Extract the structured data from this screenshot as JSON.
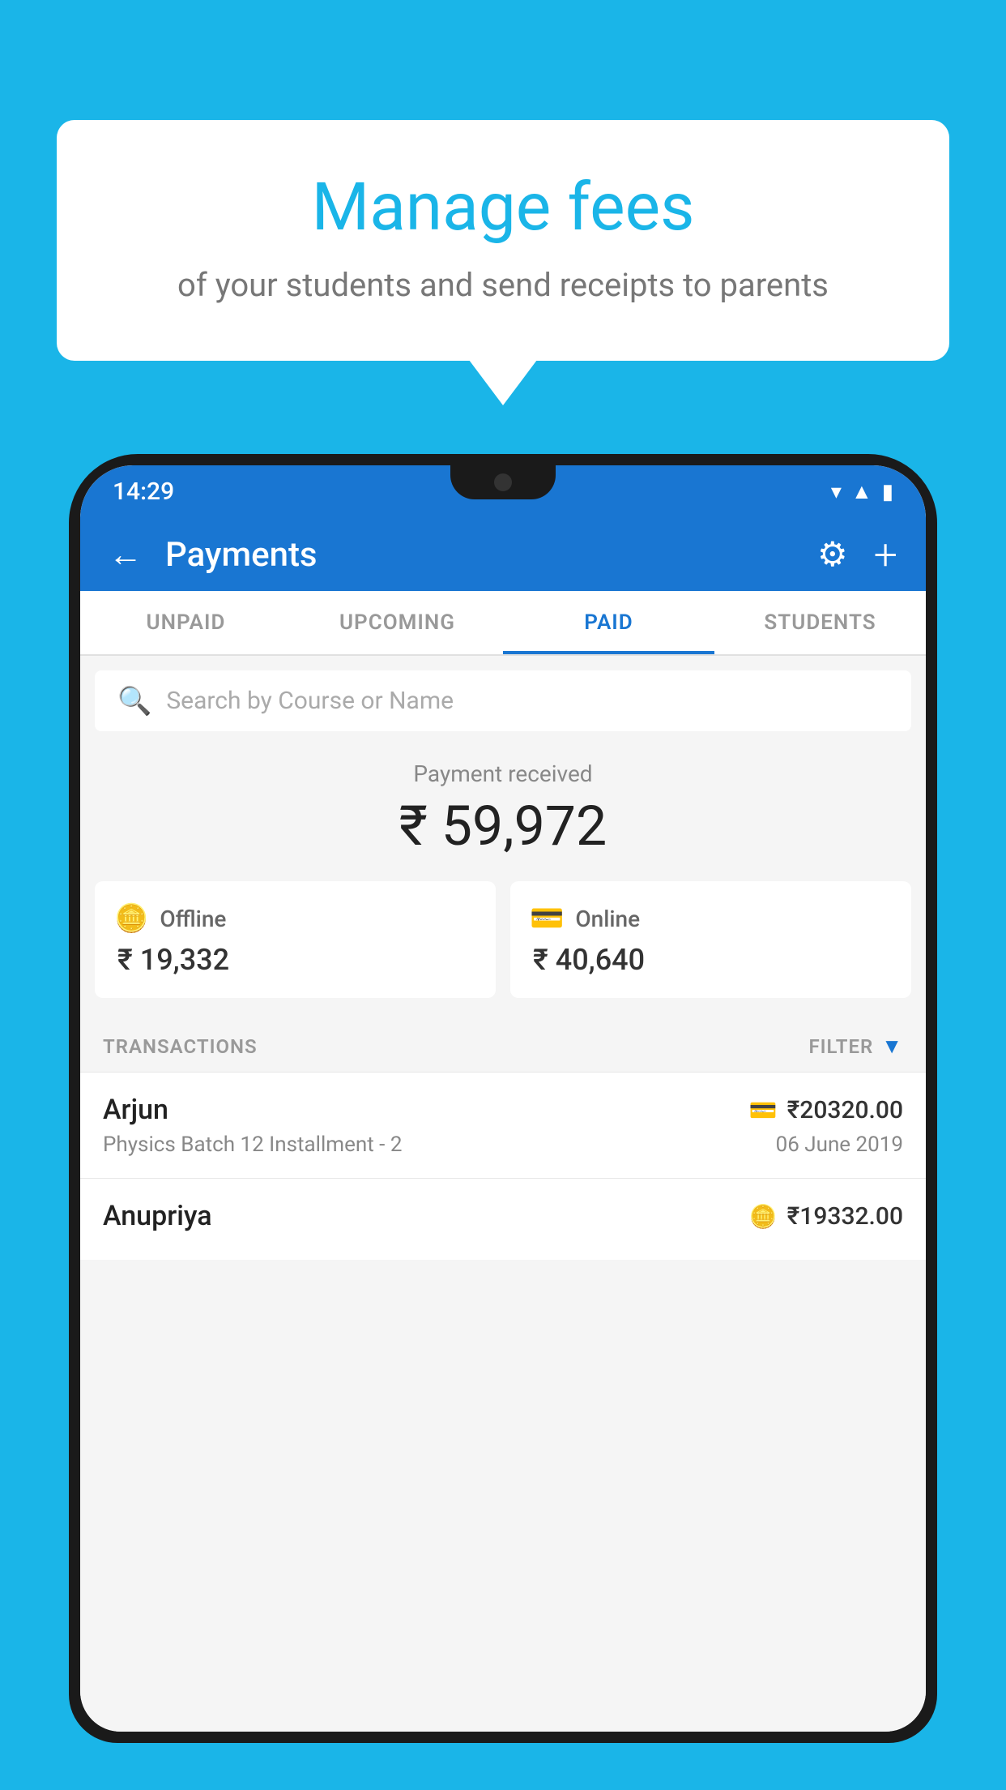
{
  "background_color": "#1ab5e8",
  "bubble": {
    "title": "Manage fees",
    "subtitle": "of your students and send receipts to parents"
  },
  "phone": {
    "status_bar": {
      "time": "14:29"
    },
    "header": {
      "title": "Payments",
      "back_label": "←",
      "gear_label": "⚙",
      "plus_label": "+"
    },
    "tabs": [
      {
        "label": "UNPAID",
        "active": false
      },
      {
        "label": "UPCOMING",
        "active": false
      },
      {
        "label": "PAID",
        "active": true
      },
      {
        "label": "STUDENTS",
        "active": false
      }
    ],
    "search": {
      "placeholder": "Search by Course or Name"
    },
    "payment_received": {
      "label": "Payment received",
      "amount": "₹ 59,972"
    },
    "payment_cards": [
      {
        "icon": "offline",
        "label": "Offline",
        "amount": "₹ 19,332"
      },
      {
        "icon": "online",
        "label": "Online",
        "amount": "₹ 40,640"
      }
    ],
    "transactions_label": "TRANSACTIONS",
    "filter_label": "FILTER",
    "transactions": [
      {
        "name": "Arjun",
        "amount": "₹20320.00",
        "payment_type": "online",
        "course": "Physics Batch 12 Installment - 2",
        "date": "06 June 2019"
      },
      {
        "name": "Anupriya",
        "amount": "₹19332.00",
        "payment_type": "offline",
        "course": "",
        "date": ""
      }
    ]
  }
}
